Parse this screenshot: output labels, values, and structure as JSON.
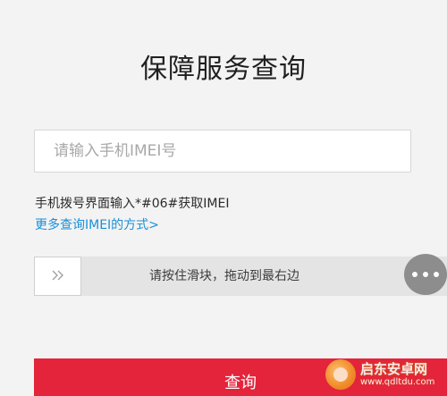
{
  "page": {
    "title": "保障服务查询"
  },
  "imei_input": {
    "placeholder": "请输入手机IMEI号",
    "value": ""
  },
  "hint": {
    "text": "手机拨号界面输入*#06#获取IMEI"
  },
  "more_link": {
    "text": "更多查询IMEI的方式>"
  },
  "slider": {
    "handle_symbol": "»",
    "instruction": "请按住滑块，拖动到最右边",
    "progress": 0
  },
  "query_button": {
    "label": "查询"
  },
  "watermark": {
    "name": "启东安卓网",
    "url": "www.qdltdu.com"
  },
  "colors": {
    "background": "#f3f3f3",
    "accent_red": "#e3243b",
    "link_blue": "#1a8fd8",
    "slider_track": "#e4e4e4",
    "fab_gray": "#8d8d8d"
  },
  "icons": {
    "slider_handle": "double-chevron-right-icon",
    "floating_button": "more-dots-icon",
    "watermark_logo": "site-logo-icon"
  }
}
